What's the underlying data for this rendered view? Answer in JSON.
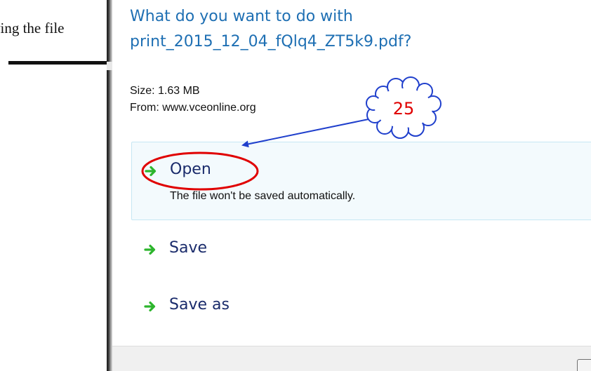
{
  "background_page": {
    "text": "ving the file"
  },
  "dialog": {
    "title_line1": "What do you want to do with",
    "title_line2": "print_2015_12_04_fQlq4_ZT5k9.pdf?",
    "size_line": "Size: 1.63 MB",
    "from_line": "From: www.vceonline.org",
    "options": [
      {
        "label": "Open",
        "description": "The file won't be saved automatically.",
        "icon": "green-arrow-right-icon"
      },
      {
        "label": "Save",
        "icon": "green-arrow-right-icon"
      },
      {
        "label": "Save as",
        "icon": "green-arrow-right-icon"
      }
    ]
  },
  "annotation": {
    "step_number": "25",
    "highlight_color": "#e00000",
    "arrow_color": "#1f3fcc"
  },
  "colors": {
    "title": "#1e6fb3",
    "option_label": "#1a2b6b",
    "option_highlight_bg": "#f3fafd",
    "option_highlight_border": "#c6e7f3",
    "arrow_green": "#2db52d"
  }
}
